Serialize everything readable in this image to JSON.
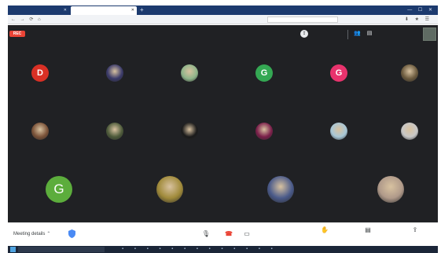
{
  "browser": {
    "tabs": [
      {
        "label": "",
        "active": false
      },
      {
        "label": "",
        "active": true
      }
    ],
    "new_tab_icon": "plus-icon",
    "address": {
      "url_prefix": "",
      "url_host": "",
      "url_rest": ""
    },
    "search_placeholder": ""
  },
  "meeting": {
    "recording_label": "REC",
    "presenting_notice": "",
    "time": "",
    "participants_row1": [
      {
        "initial": "D",
        "color": "#d93025",
        "photo": false
      },
      {
        "initial": "",
        "color": "#3a3a6a",
        "photo": true
      },
      {
        "initial": "",
        "color": "#8fb58a",
        "photo": true
      },
      {
        "initial": "G",
        "color": "#34a853",
        "photo": false
      },
      {
        "initial": "G",
        "color": "#e8336d",
        "photo": false
      },
      {
        "initial": "",
        "color": "#6b5a3e",
        "photo": true
      }
    ],
    "participants_row2": [
      {
        "initial": "",
        "color": "#7a5238",
        "photo": true
      },
      {
        "initial": "",
        "color": "#4d5a3a",
        "photo": true
      },
      {
        "initial": "",
        "color": "#1a1a1a",
        "photo": true
      },
      {
        "initial": "",
        "color": "#7a1f4a",
        "photo": true
      },
      {
        "initial": "",
        "color": "#a8c8d8",
        "photo": true
      },
      {
        "initial": "",
        "color": "#c8c8c8",
        "photo": true
      }
    ],
    "participants_row3": [
      {
        "initial": "G",
        "color": "#5cad3c",
        "photo": false
      },
      {
        "initial": "",
        "color": "#a08a3a",
        "photo": true
      },
      {
        "initial": "",
        "color": "#4a5a8a",
        "photo": true
      },
      {
        "initial": "",
        "color": "#b09a8a",
        "photo": true
      }
    ]
  },
  "controls": {
    "details_label": "Meeting details",
    "mic_icon": "microphone-icon",
    "end_icon": "end-call-icon",
    "cam_icon": "camera-icon",
    "right": [
      {
        "icon": "raise-hand-icon",
        "label": ""
      },
      {
        "icon": "captions-icon",
        "label": ""
      },
      {
        "icon": "present-icon",
        "label": ""
      }
    ]
  },
  "taskbar": {
    "search_placeholder": "",
    "clock": ""
  }
}
